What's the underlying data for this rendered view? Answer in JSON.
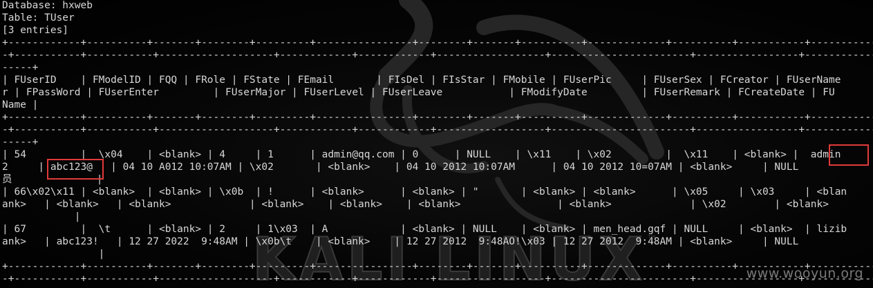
{
  "terminal": {
    "lines": [
      "Database: hxweb",
      "Table: TUser",
      "[3 entries]",
      "+------------+----------+-------+--------+---------+----------------+--------+-------+----------+-------------+----------+-----------+-------------+-------------",
      "-+-----------+-----------+-------------------+------------+------------+------------------+-----------------------+-----------------+---------------------+---",
      "-----+",
      "| FUserID    | FModelID | FQQ | FRole | FState | FEmail       | FIsDel | FIsStar | FMobile | FUserPic     | FUserSex | FCreator | FUserName",
      "r | FPassWord | FUserEnter         | FUserMajor | FUserLevel | FUserLeave           | FModifyDate         | FUserRemark | FCreateDate | FU",
      "Name |",
      "+------------+----------+-------+--------+---------+----------------+--------+-------+----------+-------------+----------+-----------+-------------+-------------",
      "-+-----------+-----------+-------------------+------------+------------+------------------+-----------------------+-----------------+---------------------+---",
      "-----+",
      "| 54         |  \\x04    | <blank> | 4     | 1      | admin@qq.com | 0      | NULL    | \\x11    | \\x02         |  \\x11    | <blank> |  admin",
      "2     | abc123@   | 04 10 A012 10:07AM | \\x02       | <blank>    | 04 10 2012 10:07AM      | 04 10 2012 10=07AM | <blank>     | NULL",
      "员              |",
      "| 66\\x02\\x11 | <blank>  | <blank> | \\x0b  | !      | <blank>      | <blank> | \"       | <blank> | <blank>      | \\x05     | \\x03     | <blan",
      "ank>   | <blank>   | <blank>             | <blank>    | <blank>    | <blank>                | <blank>             | \\x02        | <blank>",
      "            |",
      "| 67         |  \\t      | <blank> | 2     | 1\\x03  | A            | <blank> | NULL    | <blank> | men_head.gqf | NULL     | <blank>  | lizib",
      "ank>   | abc123!   | 12 27 2022  9:48AM | \\x0b\\t    | <blank>    | 12 27 2012  9:48AO!\\x03 | 12 27 2012  9:48AM | <blank>     | NULL",
      "                |",
      "+------------+----------+-------+--------+---------+----------------+--------+-------+----------+-------------+----------+-----------+-------------+-------------",
      "-+-----------+-----------+-------------------+------------+------------+------------------+-----------------------+-----------------+---------------------+---",
      "-----+"
    ]
  },
  "background": {
    "brand_text": "KALI LINUX",
    "trademark": "™"
  },
  "watermark": "www.wooyun.org",
  "colors": {
    "background": "#000000",
    "text": "#d8d8d8",
    "highlight_box": "#e03a3a",
    "logo_art": "#2a2a2a"
  }
}
